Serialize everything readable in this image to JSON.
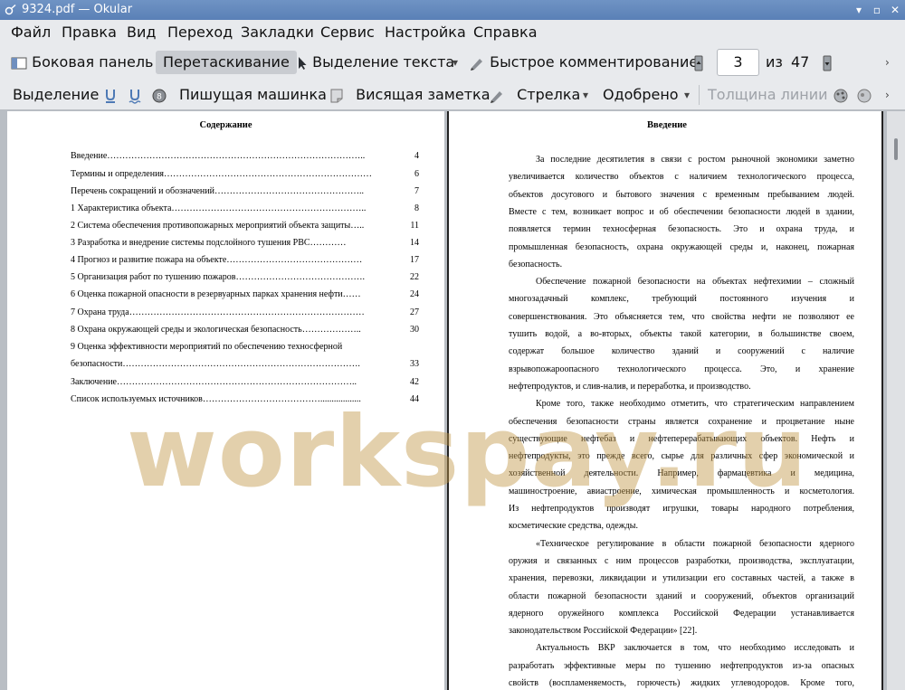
{
  "window": {
    "title": "9324.pdf  — Okular"
  },
  "menu": [
    "Файл",
    "Правка",
    "Вид",
    "Переход",
    "Закладки",
    "Сервис",
    "Настройка",
    "Справка"
  ],
  "toolbar1": {
    "sidebar": "Боковая панель",
    "drag": "Перетаскивание",
    "text_select": "Выделение текста",
    "quick_comment": "Быстрое комментирование",
    "page_current": "3",
    "page_of": "из",
    "page_total": "47"
  },
  "toolbar2": {
    "selection": "Выделение",
    "typewriter": "Пишущая машинка",
    "sticky_note": "Висящая заметка",
    "arrow": "Стрелка",
    "approved": "Одобрено",
    "line_width": "Толщина линии"
  },
  "watermark": "workspay.ru",
  "left_page": {
    "heading": "Содержание",
    "toc": [
      {
        "title": "Введение…………………………………………………………………………..",
        "page": "4"
      },
      {
        "title": "Термины и определения……………………………………………………………",
        "page": "6"
      },
      {
        "title": "Перечень сокращений и обозначений…………………………………………..",
        "page": "7"
      },
      {
        "title": "1 Характеристика объекта………………………………………………………..",
        "page": "8"
      },
      {
        "title": "2 Система обеспечения противопожарных мероприятий объекта защиты…..",
        "page": "11"
      },
      {
        "title": "3 Разработка и внедрение системы подслойного тушения РВС…………",
        "page": "14"
      },
      {
        "title": "4 Прогноз и развитие пожара на объекте………………………………………",
        "page": "17"
      },
      {
        "title": "5 Организация работ по тушению пожаров…………………………………….",
        "page": "22"
      },
      {
        "title": "6 Оценка пожарной опасности в резервуарных парках хранения нефти……",
        "page": "24"
      },
      {
        "title": "7 Охрана труда……………………………………………………………………",
        "page": "27"
      },
      {
        "title": "8 Охрана окружающей среды и экологическая безопасность………………..",
        "page": "30"
      },
      {
        "title": "9  Оценка  эффективности  мероприятий  по  обеспечению  техносферной",
        "page": ""
      },
      {
        "title": "безопасности…………………………………………………………………….",
        "page": "33"
      },
      {
        "title": "Заключение……………………………………………………………………..",
        "page": "42"
      },
      {
        "title": "Список используемых источников…………………………………..................",
        "page": "44"
      }
    ]
  },
  "right_page": {
    "heading": "Введение",
    "lines": [
      "За последние десятилетия в связи с ростом рыночной экономики заметно",
      "увеличивается количество объектов с наличием технологического процесса,",
      "объектов досугового и бытового значения с временным пребыванием людей.",
      "Вместе с тем, возникает вопрос и об обеспечении безопасности людей в здании,",
      "появляется термин техносферная безопасность. Это и охрана труда, и",
      "промышленная безопасность, охрана окружающей среды и, наконец, пожарная",
      "безопасность.",
      "Обеспечение пожарной безопасности на объектах нефтехимии – сложный",
      "многозадачный комплекс, требующий постоянного изучения и",
      "совершенствования. Это объясняется тем, что свойства нефти не позволяют ее",
      "тушить водой, а во-вторых, объекты такой категории, в большинстве своем,",
      "содержат большое количество зданий и сооружений с наличие",
      "взрывопожароопасного технологического процесса. Это, и хранение",
      "нефтепродуктов, и слив-налив, и переработка, и производство.",
      "Кроме того, также необходимо отметить, что стратегическим направлением",
      "обеспечения безопасности страны является сохранение и процветание ныне",
      "существующие нефтебаз и нефтеперерабатывающих объектов. Нефть и",
      "нефтепродукты, это прежде всего, сырье для различных сфер экономической и",
      "хозяйственной деятельности. Например, фармацевтика и медицина,",
      "машиностроение, авиастроение, химическая промышленность и косметология.",
      "Из нефтепродуктов производят игрушки, товары народного потребления,",
      "косметические средства, одежды.",
      "«Техническое регулирование в области пожарной безопасности ядерного",
      "оружия и связанных с ним процессов разработки, производства, эксплуатации,",
      "хранения, перевозки, ликвидации и утилизации его составных частей, а также в",
      "области пожарной безопасности зданий и сооружений, объектов организаций",
      "ядерного оружейного комплекса Российской Федерации устанавливается",
      "законодательством Российской Федерации» [22].",
      "Актуальность ВКР заключается в том, что необходимо исследовать и",
      "разработать эффективные меры по тушению нефтепродуктов из-за опасных",
      "свойств (воспламеняемость, горючесть) жидких углеводородов. Кроме того,"
    ]
  }
}
